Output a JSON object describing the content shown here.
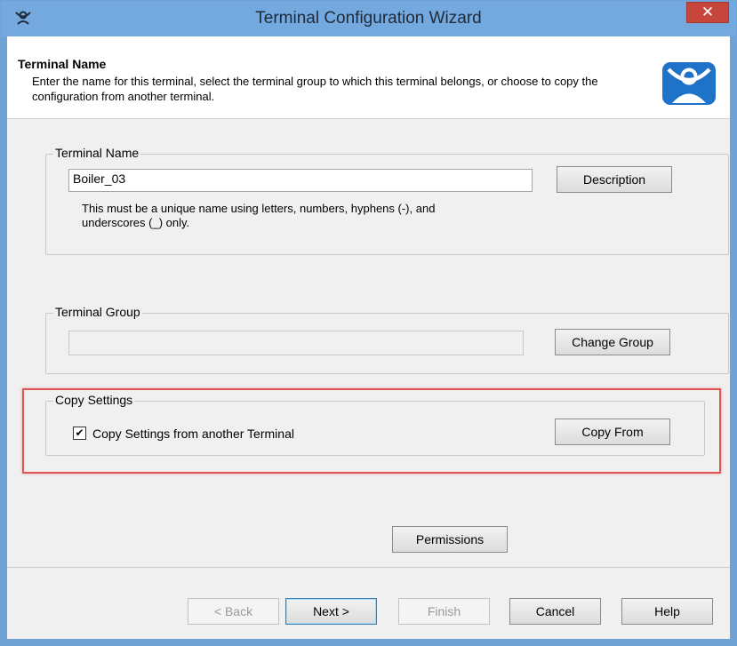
{
  "window": {
    "title": "Terminal Configuration Wizard",
    "close_glyph": "✕"
  },
  "header": {
    "title": "Terminal Name",
    "description": "Enter the name for this terminal, select the terminal group to which this terminal belongs, or choose to copy the configuration from another terminal."
  },
  "terminal_name": {
    "legend": "Terminal Name",
    "value": "Boiler_03",
    "hint": "This must be a unique name using letters, numbers, hyphens (-), and underscores (_) only.",
    "description_button": "Description"
  },
  "terminal_group": {
    "legend": "Terminal Group",
    "value": "",
    "change_button": "Change Group"
  },
  "copy_settings": {
    "legend": "Copy Settings",
    "checkbox_label": "Copy Settings from another Terminal",
    "checked": true,
    "copy_button": "Copy From"
  },
  "permissions_button": "Permissions",
  "footer": {
    "back": "< Back",
    "next": "Next >",
    "finish": "Finish",
    "cancel": "Cancel",
    "help": "Help"
  },
  "colors": {
    "titlebar": "#73a9de",
    "close": "#c7463c",
    "highlight": "#e05454",
    "logo": "#1e73c8"
  }
}
